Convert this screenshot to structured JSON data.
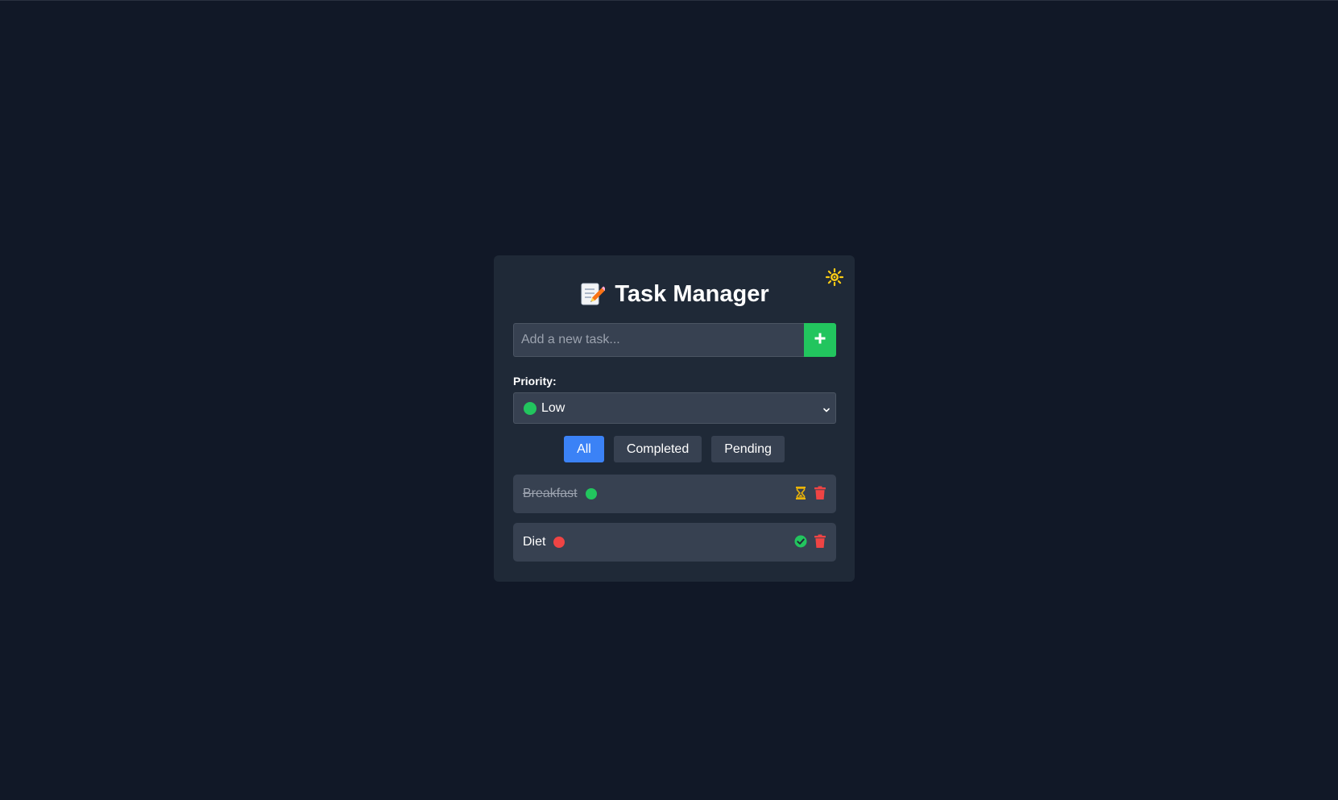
{
  "app": {
    "title": "Task Manager",
    "title_icon": "memo-pencil-icon",
    "theme_toggle_icon": "sun-icon"
  },
  "add_task": {
    "placeholder": "Add a new task...",
    "value": "",
    "button_icon": "plus-icon"
  },
  "priority": {
    "label": "Priority:",
    "selected": "Low",
    "selected_color": "#22c55e"
  },
  "filters": [
    {
      "label": "All",
      "active": true
    },
    {
      "label": "Completed",
      "active": false
    },
    {
      "label": "Pending",
      "active": false
    }
  ],
  "tasks": [
    {
      "name": "Breakfast",
      "completed": true,
      "priority_color": "#22c55e",
      "toggle_icon": "hourglass-icon",
      "delete_icon": "trash-icon"
    },
    {
      "name": "Diet",
      "completed": false,
      "priority_color": "#ef4444",
      "toggle_icon": "check-circle-icon",
      "delete_icon": "trash-icon"
    }
  ],
  "colors": {
    "background": "#111827",
    "card": "#1f2937",
    "surface": "#374151",
    "accent_blue": "#3b82f6",
    "accent_green": "#22c55e",
    "danger_red": "#ef4444",
    "sun_yellow": "#facc15",
    "hourglass_yellow": "#eab308"
  }
}
